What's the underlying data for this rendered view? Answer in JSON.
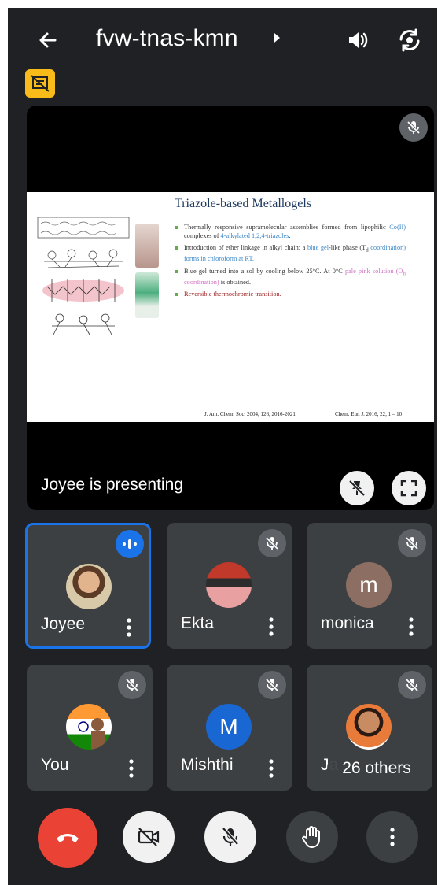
{
  "header": {
    "title": "fvw-tnas-kmn",
    "icons": [
      "back-arrow-icon",
      "title-caret-icon",
      "speaker-icon",
      "switch-camera-icon",
      "captions-badge-icon"
    ]
  },
  "presentation": {
    "presenting_label": "Joyee is presenting",
    "slide": {
      "title": "Triazole-based Metallogels",
      "bullets": [
        [
          "Thermally responsive supramolecular assemblies formed from lipophilic ",
          "Co(II)",
          " complexes of ",
          "4-alkylated 1,2,4-triazoles",
          "."
        ],
        [
          "Introduction of ether linkage in alkyl chain: a ",
          "blue gel",
          "-like phase (T",
          "d",
          " coordination) forms in chloroform at RT."
        ],
        [
          "Blue gel turned into a sol by cooling below 25°C. At 0°C ",
          "pale pink solution (O",
          "h",
          " coordination)",
          " is obtained."
        ],
        [
          "Reversible thermochromic transition."
        ]
      ],
      "citation_1": "J. Am. Chem. Soc. 2004, 126, 2016-2021",
      "citation_2": "Chem. Eur. J. 2016, 22, 1 – 10"
    }
  },
  "participants": [
    {
      "name": "Joyee",
      "speaking": true,
      "avatar_type": "photo",
      "avatar_color": "#c7a27d"
    },
    {
      "name": "Ekta",
      "muted": true,
      "avatar_type": "photo",
      "avatar_color": "#d9534f"
    },
    {
      "name": "monica",
      "muted": true,
      "avatar_type": "letter",
      "letter": "m",
      "avatar_color": "#8d6e63"
    },
    {
      "name": "You",
      "muted": true,
      "avatar_type": "photo",
      "avatar_color": "#ff9933"
    },
    {
      "name": "Mishthi",
      "muted": true,
      "avatar_type": "letter",
      "letter": "M",
      "avatar_color": "#1967d2"
    },
    {
      "name": "Ja",
      "muted": true,
      "avatar_type": "photo",
      "avatar_color": "#e87a3a"
    }
  ],
  "others_label": "26 others",
  "controls": [
    "end-call",
    "camera-off",
    "mic-off",
    "raise-hand",
    "more-options"
  ],
  "colors": {
    "end_call": "#ea4335",
    "speaking": "#1a73e8",
    "badge": "#f9bb19"
  }
}
